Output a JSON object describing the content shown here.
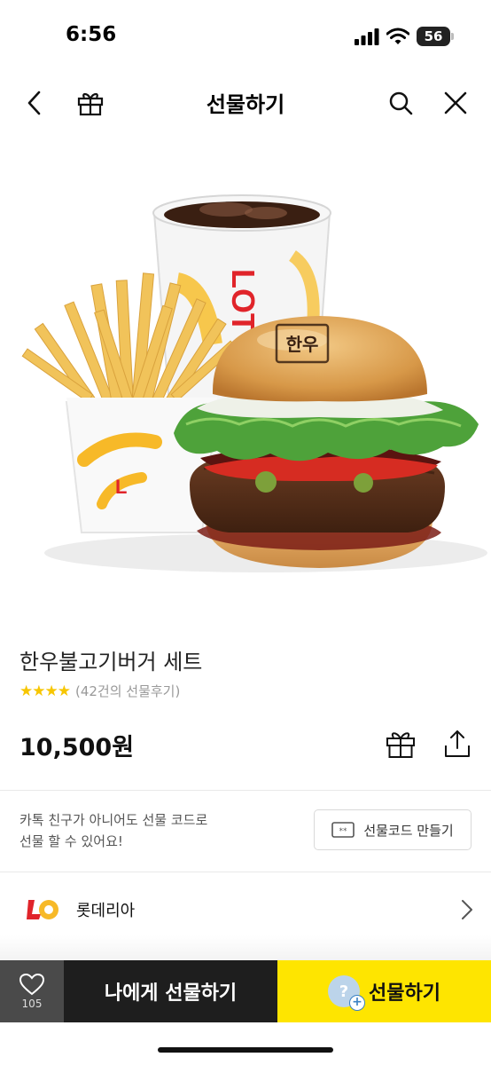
{
  "status_bar": {
    "time": "6:56",
    "battery": "56"
  },
  "header": {
    "title": "선물하기"
  },
  "product": {
    "name": "한우불고기버거 세트",
    "rating_stars": "★★★★",
    "review_count": "(42건의 선물후기)",
    "price": "10,500원",
    "image_text": {
      "cup_logo": "LOT",
      "bun_stamp": "한우"
    }
  },
  "gift_code": {
    "text_line1": "카톡 친구가 아니어도 선물 코드로",
    "text_line2": "선물 할 수 있어요!",
    "button_label": "선물코드 만들기"
  },
  "brand": {
    "name": "롯데리아"
  },
  "bottom_bar": {
    "wish_count": "105",
    "self_gift_label": "나에게 선물하기",
    "gift_label": "선물하기"
  },
  "colors": {
    "kakao_yellow": "#FEE500",
    "star": "#F7C600",
    "dark": "#1E1E1E",
    "wish_bg": "#4A4A4A",
    "brand_red": "#E0242A"
  },
  "icons": [
    "back-icon",
    "gift-icon",
    "search-icon",
    "close-icon",
    "share-icon",
    "ticket-icon",
    "chevron-right-icon",
    "heart-icon"
  ]
}
